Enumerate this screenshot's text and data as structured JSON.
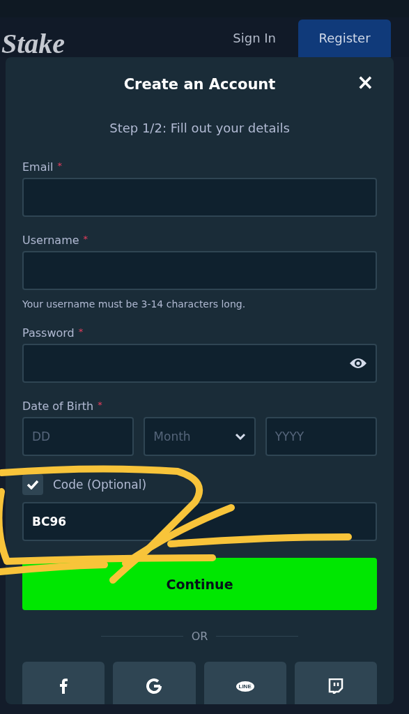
{
  "header": {
    "logo": "Stake",
    "sign_in": "Sign In",
    "register": "Register"
  },
  "modal": {
    "title": "Create an Account",
    "close": "×",
    "step": "Step 1/2: Fill out your details",
    "fields": [
      {
        "kind": "text",
        "label": "Email",
        "required": true,
        "required_mark": "*"
      },
      {
        "kind": "text",
        "label": "Username",
        "required": true,
        "required_mark": "*",
        "hint": "Your username must be 3-14 characters long."
      },
      {
        "kind": "password",
        "label": "Password",
        "required": true,
        "required_mark": "*"
      },
      {
        "kind": "date",
        "label": "Date of Birth",
        "required": true,
        "required_mark": "*",
        "parts": [
          {
            "kind": "input",
            "placeholder": "DD"
          },
          {
            "kind": "select",
            "placeholder": "Month"
          },
          {
            "kind": "input",
            "placeholder": "YYYY"
          }
        ]
      }
    ],
    "code": {
      "label": "Code (Optional)",
      "checked": true,
      "value": "BC96"
    },
    "continue": "Continue",
    "divider": "OR",
    "social": [
      {
        "kind": "facebook"
      },
      {
        "kind": "google"
      },
      {
        "kind": "line",
        "text": "LINE"
      },
      {
        "kind": "twitch"
      }
    ]
  }
}
